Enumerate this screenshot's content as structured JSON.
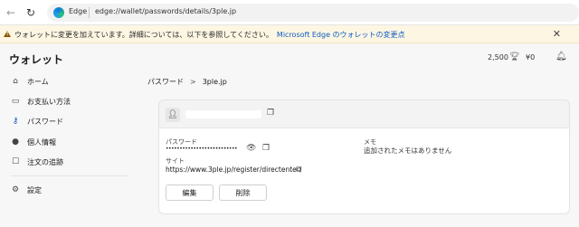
{
  "browser": {
    "chip_label": "Edge",
    "url": "edge://wallet/passwords/details/3ple.jp"
  },
  "banner": {
    "text": "ウォレットに変更を加えています。詳細については、以下を参照してください。",
    "link": "Microsoft Edge のウォレットの変更点"
  },
  "wallet": {
    "title": "ウォレット",
    "rewards_points": "2,500",
    "balance": "¥0"
  },
  "sidebar": {
    "items": [
      {
        "label": "ホーム",
        "icon": "home-icon"
      },
      {
        "label": "お支払い方法",
        "icon": "card-icon"
      },
      {
        "label": "パスワード",
        "icon": "key-icon"
      },
      {
        "label": "個人情報",
        "icon": "person-icon"
      },
      {
        "label": "注文の追跡",
        "icon": "tracking-icon"
      },
      {
        "label": "設定",
        "icon": "gear-icon"
      }
    ]
  },
  "breadcrumb": {
    "parent": "パスワード",
    "current": "3ple.jp"
  },
  "detail": {
    "password_label": "パスワード",
    "password_value": "••••••••••••••••••••••••••",
    "memo_label": "メモ",
    "memo_value": "追加されたメモはありません",
    "site_label": "サイト",
    "site_value": "https://www.3ple.jp/register/directenter/",
    "edit_button": "編集",
    "delete_button": "削除"
  },
  "colors": {
    "accent": "#1a56c8",
    "link": "#0f5cc0",
    "banner_bg": "#fdf6e3"
  }
}
